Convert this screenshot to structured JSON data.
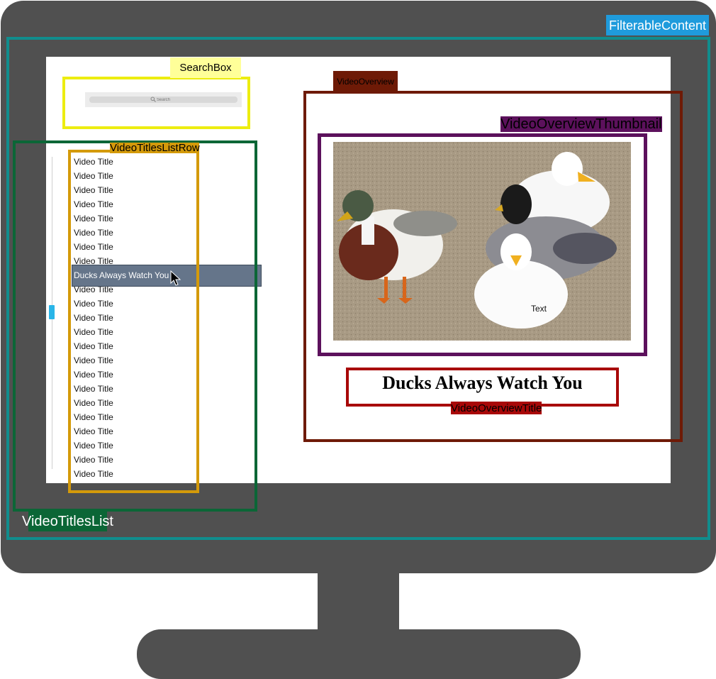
{
  "labels": {
    "filterable_content": "FilterableContent",
    "search_box": "SearchBox",
    "video_titles_list_row": "VideoTitlesListRow",
    "video_titles_list": "VideoTitlesList",
    "video_overview": "VideoOverview",
    "video_overview_thumbnail": "VideoOverviewThumbnail",
    "video_overview_title": "VideoOverviewTitle"
  },
  "search": {
    "placeholder": "Search",
    "icon": "search-icon"
  },
  "list": {
    "items": [
      "Video Title",
      "Video Title",
      "Video Title",
      "Video Title",
      "Video Title",
      "Video Title",
      "Video Title",
      "Video Title",
      "Ducks Always Watch You",
      "Video Title",
      "Video Title",
      "Video Title",
      "Video Title",
      "Video Title",
      "Video Title",
      "Video Title",
      "Video Title",
      "Video Title",
      "Video Title",
      "Video Title",
      "Video Title",
      "Video Title",
      "Video Title"
    ],
    "selected": "Ducks Always Watch You"
  },
  "overview": {
    "thumbnail_caption": "Text",
    "title": "Ducks Always Watch You"
  },
  "colors": {
    "monitor": "#505050",
    "filterable_content": "#108d8d",
    "search_box": "#eded10",
    "video_titles_list": "#0b6636",
    "video_titles_list_row": "#d49a0a",
    "video_overview": "#6e1a06",
    "video_overview_thumbnail": "#5c115c",
    "video_overview_title": "#a80808",
    "selected_row": "#65758a",
    "scroll_thumb": "#29b5e8"
  }
}
